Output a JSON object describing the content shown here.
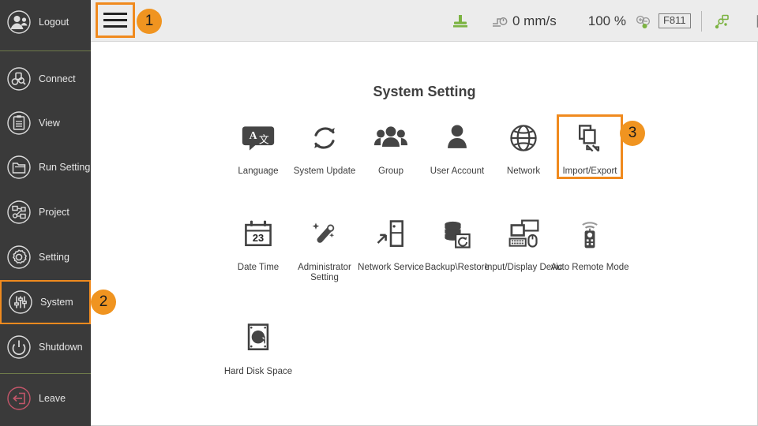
{
  "window": {
    "title": "System Setting"
  },
  "sidebar": {
    "items": [
      {
        "label": "Logout",
        "icon": "logout-icon",
        "selected": false
      },
      {
        "label": "Connect",
        "icon": "connect-icon",
        "selected": false
      },
      {
        "label": "View",
        "icon": "view-icon",
        "selected": false
      },
      {
        "label": "Run Setting",
        "icon": "run-setting-icon",
        "selected": false
      },
      {
        "label": "Project",
        "icon": "project-icon",
        "selected": false
      },
      {
        "label": "Setting",
        "icon": "setting-icon",
        "selected": false
      },
      {
        "label": "System",
        "icon": "system-icon",
        "selected": true
      },
      {
        "label": "Shutdown",
        "icon": "shutdown-icon",
        "selected": false
      },
      {
        "label": "Leave",
        "icon": "leave-icon",
        "selected": false
      }
    ]
  },
  "topbar": {
    "menu_button": "hamburger-menu-button",
    "speed": "0 mm/s",
    "zoom": "100 %",
    "frame": "F811"
  },
  "main": {
    "title": "System Setting",
    "rows": [
      [
        {
          "label": "Language",
          "icon": "language-icon",
          "selected": false
        },
        {
          "label": "System Update",
          "icon": "system-update-icon",
          "selected": false
        },
        {
          "label": "Group",
          "icon": "group-icon",
          "selected": false
        },
        {
          "label": "User Account",
          "icon": "user-account-icon",
          "selected": false
        },
        {
          "label": "Network",
          "icon": "network-icon",
          "selected": false
        },
        {
          "label": "Import/Export",
          "icon": "import-export-icon",
          "selected": true
        }
      ],
      [
        {
          "label": "Date Time",
          "icon": "date-time-icon",
          "selected": false
        },
        {
          "label": "Administrator Setting",
          "icon": "administrator-setting-icon",
          "selected": false
        },
        {
          "label": "Network Service",
          "icon": "network-service-icon",
          "selected": false
        },
        {
          "label": "Backup\\Restore",
          "icon": "backup-restore-icon",
          "selected": false
        },
        {
          "label": "Input/Display Devic",
          "icon": "input-display-device-icon",
          "selected": false
        },
        {
          "label": "Auto Remote Mode",
          "icon": "auto-remote-mode-icon",
          "selected": false
        }
      ],
      [
        {
          "label": "Hard Disk Space",
          "icon": "hard-disk-space-icon",
          "selected": false
        }
      ]
    ]
  },
  "badges": [
    {
      "number": "1"
    },
    {
      "number": "2"
    },
    {
      "number": "3"
    }
  ],
  "colors": {
    "accent": "#f08a1e",
    "sidebar_bg": "#3a3a3a",
    "topbar_bg": "#ececec",
    "status_green": "#7cb342",
    "leave_red": "#c4566a",
    "separator_green": "#6e7a4a"
  }
}
